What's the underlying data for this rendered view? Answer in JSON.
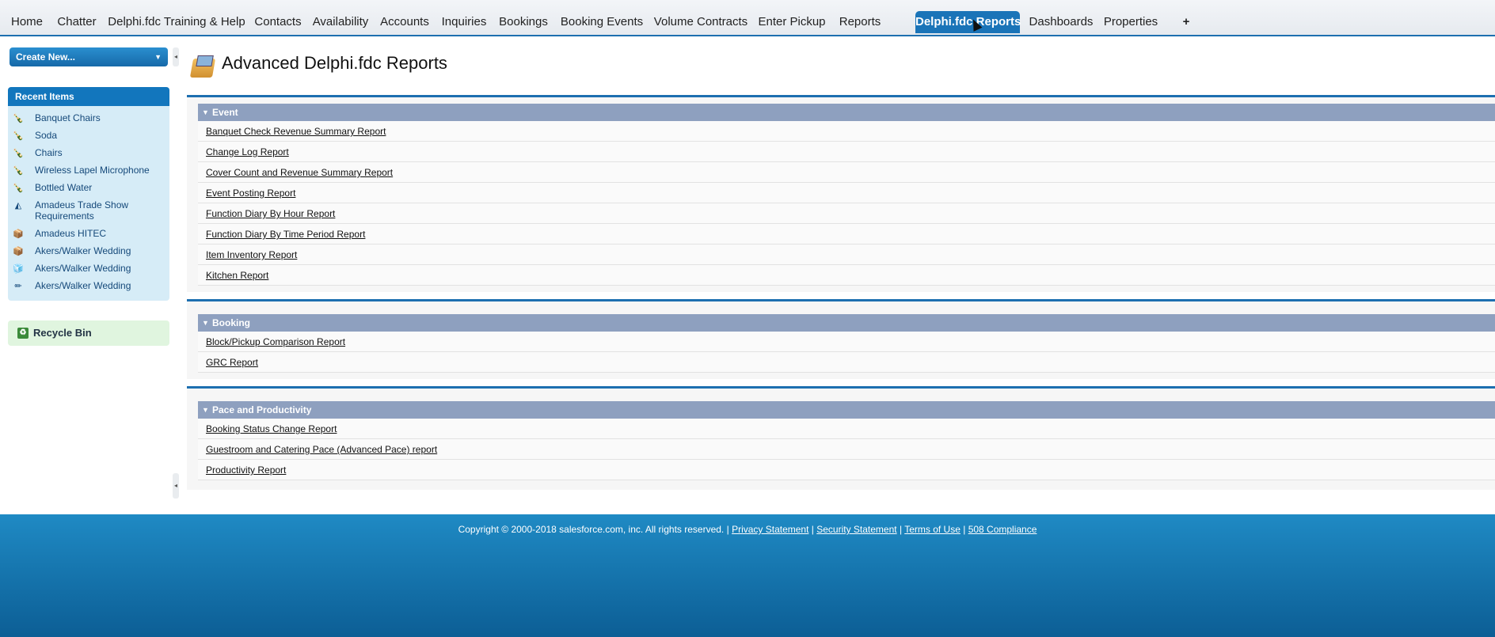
{
  "tabs": [
    {
      "label": "Home"
    },
    {
      "label": "Chatter"
    },
    {
      "label": "Delphi.fdc Training & Help"
    },
    {
      "label": "Contacts"
    },
    {
      "label": "Availability"
    },
    {
      "label": "Accounts"
    },
    {
      "label": "Inquiries"
    },
    {
      "label": "Bookings"
    },
    {
      "label": "Booking Events"
    },
    {
      "label": "Volume Contracts"
    },
    {
      "label": "Enter Pickup"
    },
    {
      "label": "Reports"
    },
    {
      "label": "Delphi.fdc Reports",
      "active": true
    },
    {
      "label": "Dashboards"
    },
    {
      "label": "Properties"
    },
    {
      "label": "+"
    }
  ],
  "sidebar": {
    "create_new_label": "Create New...",
    "recent_title": "Recent Items",
    "recent_items": [
      {
        "label": "Banquet Chairs",
        "icon": "item-icon"
      },
      {
        "label": "Soda",
        "icon": "item-icon"
      },
      {
        "label": "Chairs",
        "icon": "item-icon"
      },
      {
        "label": "Wireless Lapel Microphone",
        "icon": "item-icon"
      },
      {
        "label": "Bottled Water",
        "icon": "item-icon"
      },
      {
        "label": "Amadeus Trade Show Requirements",
        "icon": "requirement-icon"
      },
      {
        "label": "Amadeus HITEC",
        "icon": "booking-icon"
      },
      {
        "label": "Akers/Walker Wedding",
        "icon": "booking-icon"
      },
      {
        "label": "Akers/Walker Wedding",
        "icon": "event-icon"
      },
      {
        "label": "Akers/Walker Wedding",
        "icon": "pencil-icon"
      }
    ],
    "recycle_bin_label": "Recycle Bin"
  },
  "main": {
    "title": "Advanced Delphi.fdc Reports",
    "sections": [
      {
        "name": "Event",
        "reports": [
          "Banquet Check Revenue Summary Report",
          "Change Log Report",
          "Cover Count and Revenue Summary Report",
          "Event Posting Report",
          "Function Diary By Hour Report",
          "Function Diary By Time Period Report",
          "Item Inventory Report",
          "Kitchen Report"
        ]
      },
      {
        "name": "Booking",
        "reports": [
          "Block/Pickup Comparison Report",
          "GRC Report"
        ]
      },
      {
        "name": "Pace and Productivity",
        "reports": [
          "Booking Status Change Report",
          "Guestroom and Catering Pace (Advanced Pace) report",
          "Productivity Report"
        ]
      }
    ]
  },
  "footer": {
    "copyright": "Copyright © 2000-2018 salesforce.com, inc. All rights reserved. |",
    "links": [
      "Privacy Statement",
      "Security Statement",
      "Terms of Use",
      "508 Compliance"
    ]
  },
  "colors": {
    "accent": "#1a74b8",
    "section_header": "#8ea0bf",
    "recent_bg": "#d6ecf7",
    "recycle_bg": "#e0f5df"
  }
}
